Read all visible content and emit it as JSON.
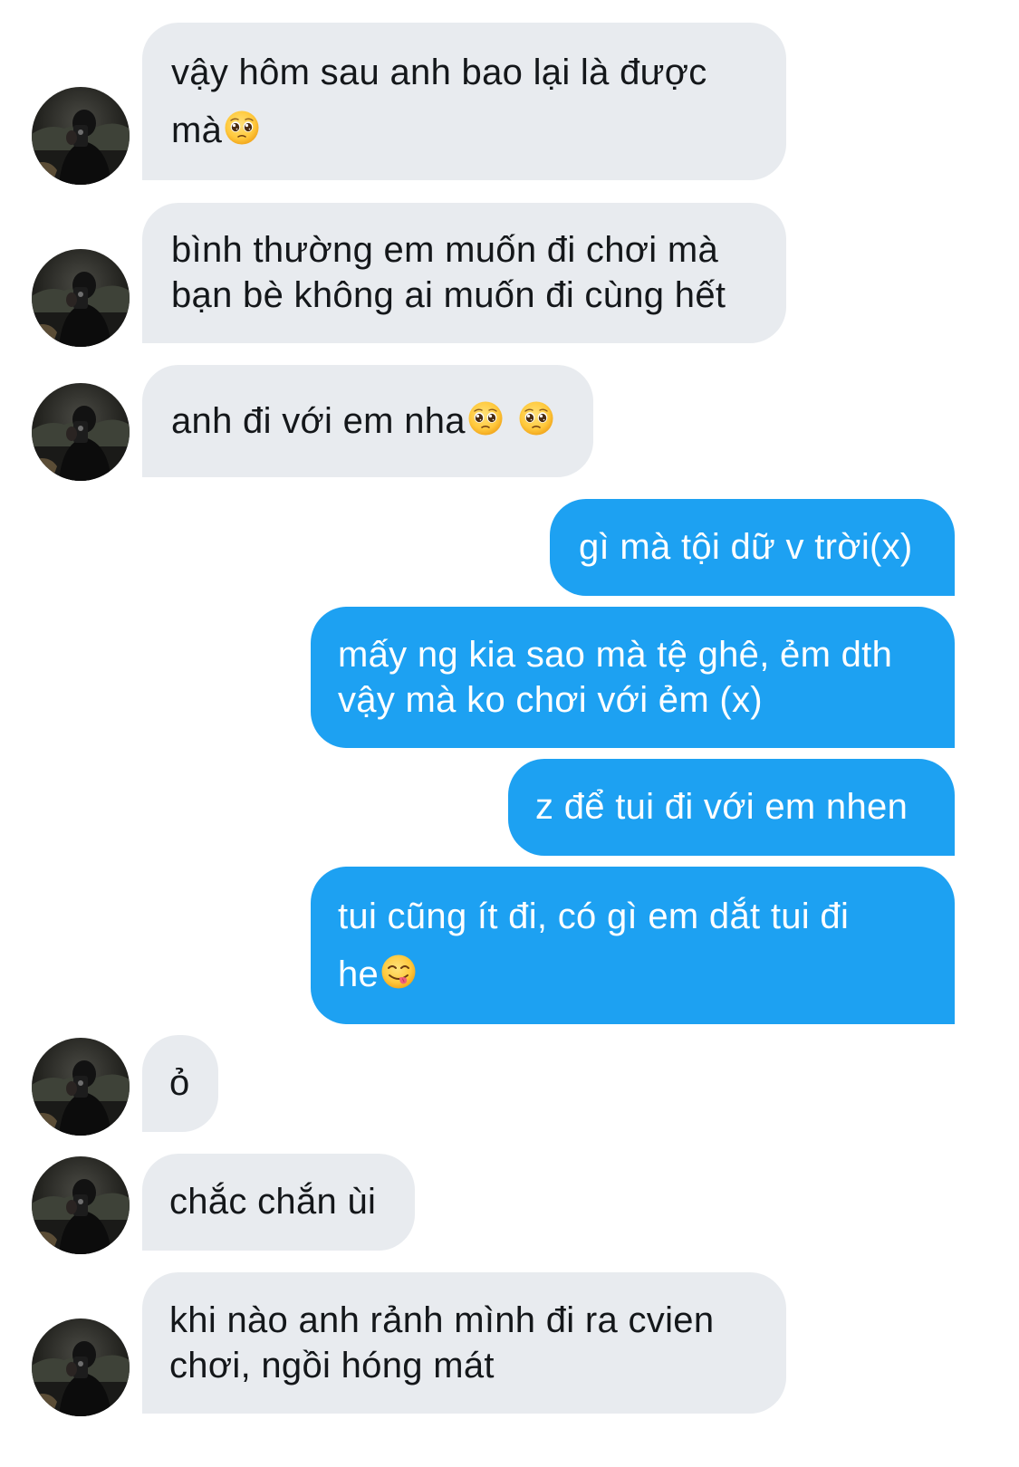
{
  "conversation": {
    "messages": [
      {
        "from": "other",
        "lines": [
          "vậy hôm sau anh bao lại là được",
          "mà"
        ],
        "emoji": [
          "pleading-face"
        ]
      },
      {
        "from": "other",
        "lines": [
          "bình thường em muốn đi chơi mà",
          "bạn bè không ai muốn đi cùng hết"
        ]
      },
      {
        "from": "other",
        "lines": [
          "anh đi với em nha"
        ],
        "emoji": [
          "pleading-face",
          "pleading-face"
        ]
      },
      {
        "from": "me",
        "lines": [
          "gì mà tội dữ v trời(x)"
        ]
      },
      {
        "from": "me",
        "lines": [
          "mấy ng kia sao mà tệ ghê, ẻm dth",
          "vậy mà ko chơi với ẻm (x)"
        ]
      },
      {
        "from": "me",
        "lines": [
          "z để tui đi với em nhen"
        ]
      },
      {
        "from": "me",
        "lines": [
          "tui cũng ít đi, có gì em dắt tui đi",
          "he"
        ],
        "emoji": [
          "savoring-food-face"
        ]
      },
      {
        "from": "other",
        "lines": [
          "ỏ"
        ]
      },
      {
        "from": "other",
        "lines": [
          "chắc chắn ùi"
        ]
      },
      {
        "from": "other",
        "lines": [
          "khi nào anh rảnh mình đi ra cvien",
          "chơi, ngồi hóng mát"
        ]
      }
    ]
  },
  "colors": {
    "incoming_bubble": "#e8ebef",
    "outgoing_bubble": "#1da1f2",
    "incoming_text": "#14171a",
    "outgoing_text": "#ffffff"
  },
  "icons": {
    "avatar": "contact-avatar-photo",
    "pleading": "pleading-face-emoji",
    "savoring": "face-savoring-food-emoji"
  }
}
